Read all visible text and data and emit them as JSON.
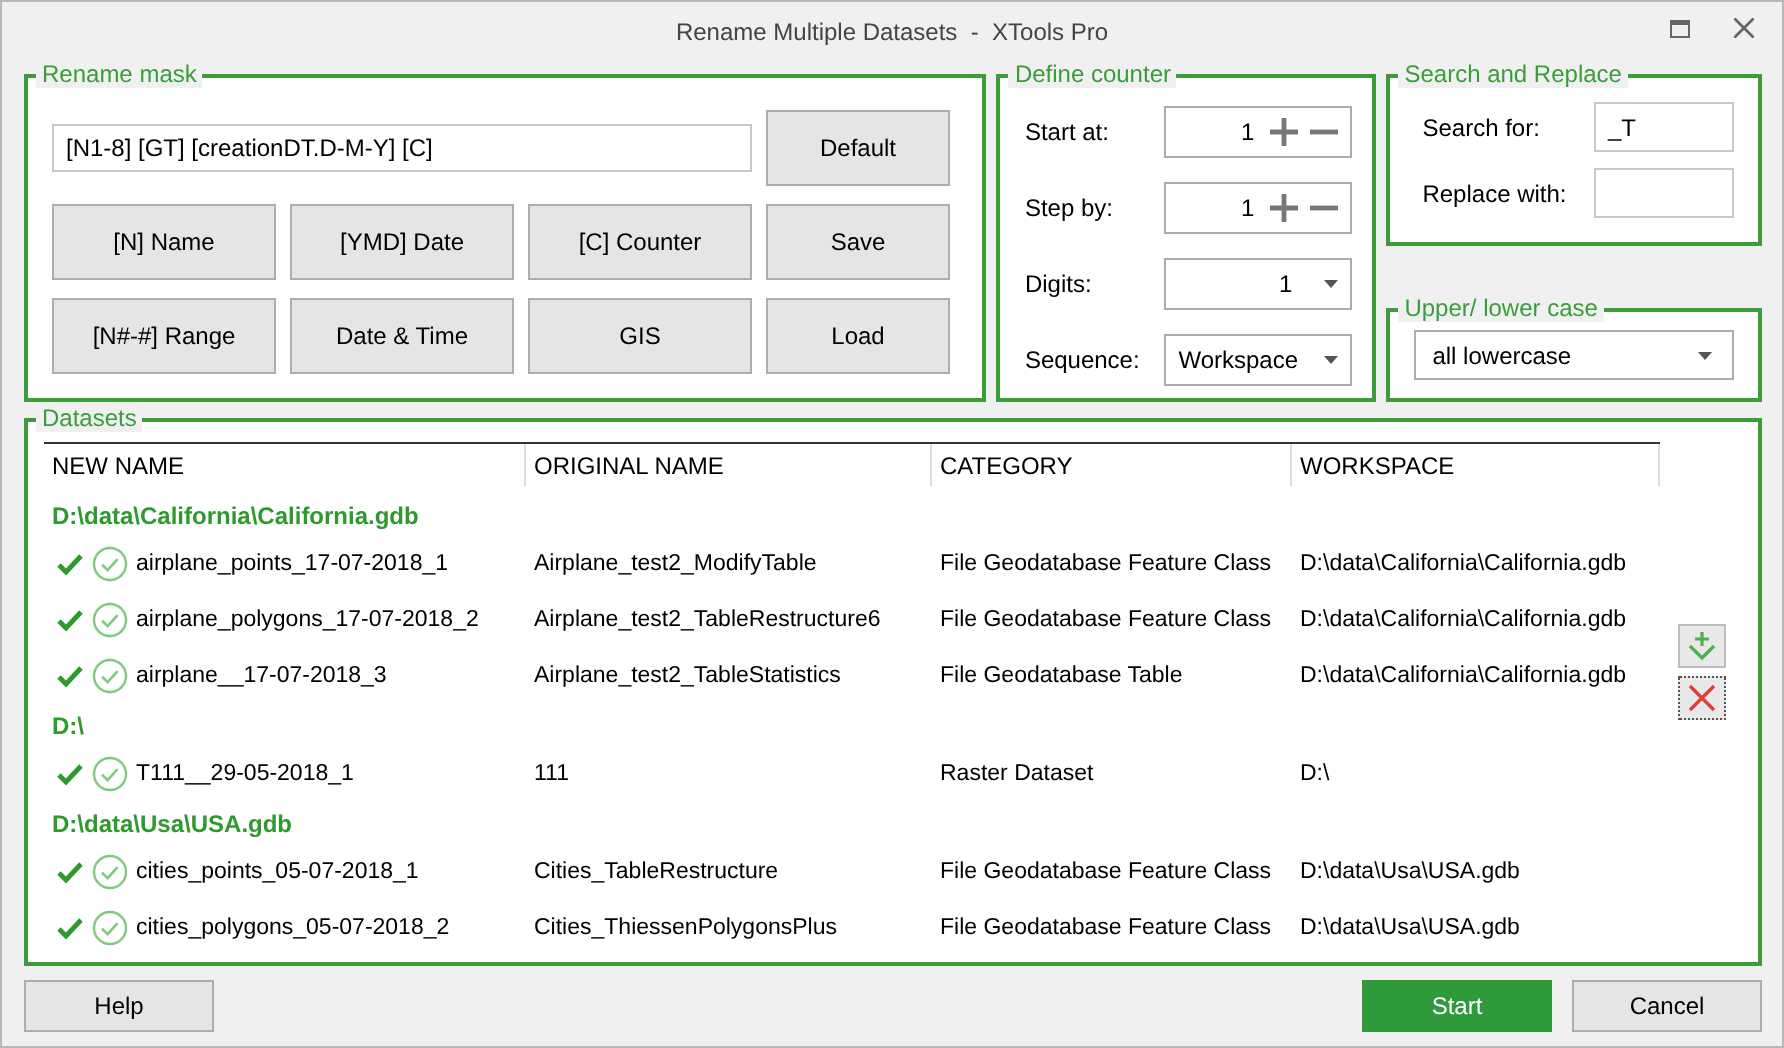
{
  "window": {
    "title": "Rename Multiple Datasets  -  XTools Pro"
  },
  "rename_mask": {
    "title": "Rename mask",
    "mask": "[N1-8] [GT] [creationDT.D-M-Y] [C]",
    "buttons": [
      "Default",
      "[N] Name",
      "[YMD] Date",
      "[C] Counter",
      "Save",
      "[N#-#] Range",
      "Date & Time",
      "GIS",
      "Load"
    ]
  },
  "define_counter": {
    "title": "Define counter",
    "fields": [
      {
        "kind": "spinner",
        "label": "Start at:",
        "value": "1"
      },
      {
        "kind": "spinner",
        "label": "Step by:",
        "value": "1"
      },
      {
        "kind": "number-dropdown",
        "label": "Digits:",
        "value": "1"
      },
      {
        "kind": "dropdown",
        "label": "Sequence:",
        "value": "Workspace"
      }
    ]
  },
  "search_replace": {
    "title": "Search and Replace",
    "fields": [
      {
        "label": "Search for:",
        "value": "_T"
      },
      {
        "label": "Replace with:"
      }
    ]
  },
  "case": {
    "title": "Upper/ lower case",
    "value": "all lowercase"
  },
  "datasets": {
    "title": "Datasets",
    "columns": [
      "NEW NAME",
      "ORIGINAL NAME",
      "CATEGORY",
      "WORKSPACE"
    ],
    "groups": [
      {
        "path": "D:\\data\\California\\California.gdb",
        "rows": [
          {
            "checked": true,
            "valid": true,
            "cells": [
              "airplane_points_17-07-2018_1",
              "Airplane_test2_ModifyTable",
              "File Geodatabase Feature Class",
              "D:\\data\\California\\California.gdb"
            ]
          },
          {
            "checked": true,
            "valid": true,
            "cells": [
              "airplane_polygons_17-07-2018_2",
              "Airplane_test2_TableRestructure6",
              "File Geodatabase Feature Class",
              "D:\\data\\California\\California.gdb"
            ]
          },
          {
            "checked": true,
            "valid": true,
            "cells": [
              "airplane__17-07-2018_3",
              "Airplane_test2_TableStatistics",
              "File Geodatabase Table",
              "D:\\data\\California\\California.gdb"
            ]
          }
        ]
      },
      {
        "path": "D:\\",
        "rows": [
          {
            "checked": true,
            "valid": true,
            "cells": [
              "T111__29-05-2018_1",
              "111",
              "Raster Dataset",
              "D:\\"
            ]
          }
        ]
      },
      {
        "path": "D:\\data\\Usa\\USA.gdb",
        "rows": [
          {
            "checked": true,
            "valid": true,
            "cells": [
              "cities_points_05-07-2018_1",
              "Cities_TableRestructure",
              "File Geodatabase Feature Class",
              "D:\\data\\Usa\\USA.gdb"
            ]
          },
          {
            "checked": true,
            "valid": true,
            "cells": [
              "cities_polygons_05-07-2018_2",
              "Cities_ThiessenPolygonsPlus",
              "File Geodatabase Feature Class",
              "D:\\data\\Usa\\USA.gdb"
            ]
          }
        ]
      }
    ]
  },
  "buttons": [
    {
      "label": "Help",
      "primary": false
    },
    {
      "label": "Start",
      "primary": true
    },
    {
      "label": "Cancel",
      "primary": false
    }
  ]
}
